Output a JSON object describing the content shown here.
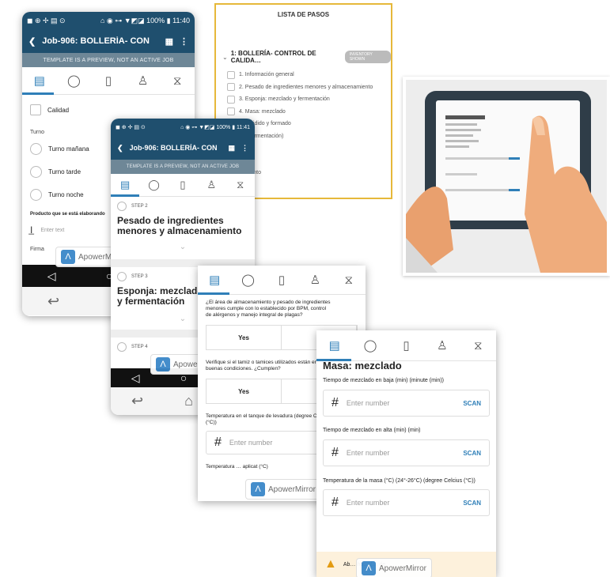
{
  "screen1": {
    "status": {
      "left": "◼ ⊕ ✢ ▤ ⊙",
      "right": "⌂ ◉ ⊶ ▼◩◪ 100% ▮ 11:40"
    },
    "title": "Job-906: BOLLERÍA- CON",
    "banner": "TEMPLATE IS A PREVIEW, NOT AN ACTIVE JOB",
    "checkbox_label": "Calidad",
    "turno_label": "Turno",
    "radios": [
      "Turno mañana",
      "Turno tarde",
      "Turno noche"
    ],
    "producto_label": "Producto que se está elaborando",
    "input_placeholder": "Enter text",
    "firma_label": "Firma"
  },
  "screen2": {
    "status": {
      "left": "◼ ⊕ ✢ ▤ ⊙",
      "right": "⌂ ◉ ⊶ ▼◩◪ 100% ▮ 11:41"
    },
    "title": "Job-906: BOLLERÍA- CON",
    "banner": "TEMPLATE IS A PREVIEW, NOT AN ACTIVE JOB",
    "step2_label": "STEP 2",
    "step2_title": "Pesado de ingredientes menores y almacenamiento",
    "step3_label": "STEP 3",
    "step3_title": "Esponja: mezclado y fermentación",
    "step4_label": "STEP 4"
  },
  "list_panel": {
    "title": "LISTA DE PASOS",
    "section": "1: BOLLERÍA- CONTROL DE CALIDA…",
    "badge": "INVENTORY SHOWN",
    "items": [
      "1. Información general",
      "2. Pesado de ingredientes menores y almacenamiento",
      "3. Esponja: mezclado y fermentación",
      "4. Masa: mezclado",
      "5. Dividido y formado",
      "…r (fermentación)",
      "…ado",
      "…o",
      "…miento",
      "…que"
    ]
  },
  "screen3": {
    "q1": "¿El área de almacenamiento y pesado de ingredientes menores cumple con lo establecido por BPM, control de alérgenos y manejo integral de plagas?",
    "yes": "Yes",
    "q2": "Verifique si el tamiz o tamices utilizados están en buenas condiciones. ¿Cumplen?",
    "q3": "Temperatura en el tanque de levadura (degree Celcius (°C))",
    "num_placeholder": "Enter number",
    "q4": "Temperatura … aplicat (°C)"
  },
  "screen4": {
    "heading": "Masa: mezclado",
    "f1": "Tiempo de mezclado en baja (min) (minute (min))",
    "f2": "Tiempo de mezclado en alta (min) (min)",
    "f3": "Temperatura de la masa (°C) (24°-26°C) (degree Celcius (°C))",
    "placeholder": "Enter number",
    "scan": "SCAN",
    "warning": "Ab… ho… (… de"
  },
  "watermark": "ApowerMirror",
  "colors": {
    "appbar": "#1f4f6e",
    "accent": "#2f7fb8",
    "list_border": "#e6b83a"
  }
}
